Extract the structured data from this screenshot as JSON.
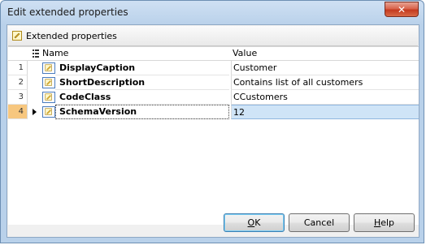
{
  "window": {
    "title": "Edit extended properties",
    "close_glyph": "✕"
  },
  "section": {
    "title": "Extended properties",
    "icon": "property-icon"
  },
  "grid": {
    "columns": {
      "name": "Name",
      "value": "Value"
    },
    "rows": [
      {
        "num": "1",
        "name": "DisplayCaption",
        "value": "Customer"
      },
      {
        "num": "2",
        "name": "ShortDescription",
        "value": "Contains list of all customers"
      },
      {
        "num": "3",
        "name": "CodeClass",
        "value": "CCustomers"
      },
      {
        "num": "4",
        "name": "SchemaVersion",
        "value": "12"
      }
    ],
    "selected_row": "4"
  },
  "buttons": {
    "ok": {
      "accel": "O",
      "rest": "K"
    },
    "cancel": {
      "label": "Cancel"
    },
    "help": {
      "accel": "H",
      "rest": "elp"
    }
  },
  "colors": {
    "accent": "#4a7bbd",
    "selected_row": "#cfe4f7",
    "selected_rownum": "#f7c77f",
    "close_button": "#c43a1f"
  }
}
